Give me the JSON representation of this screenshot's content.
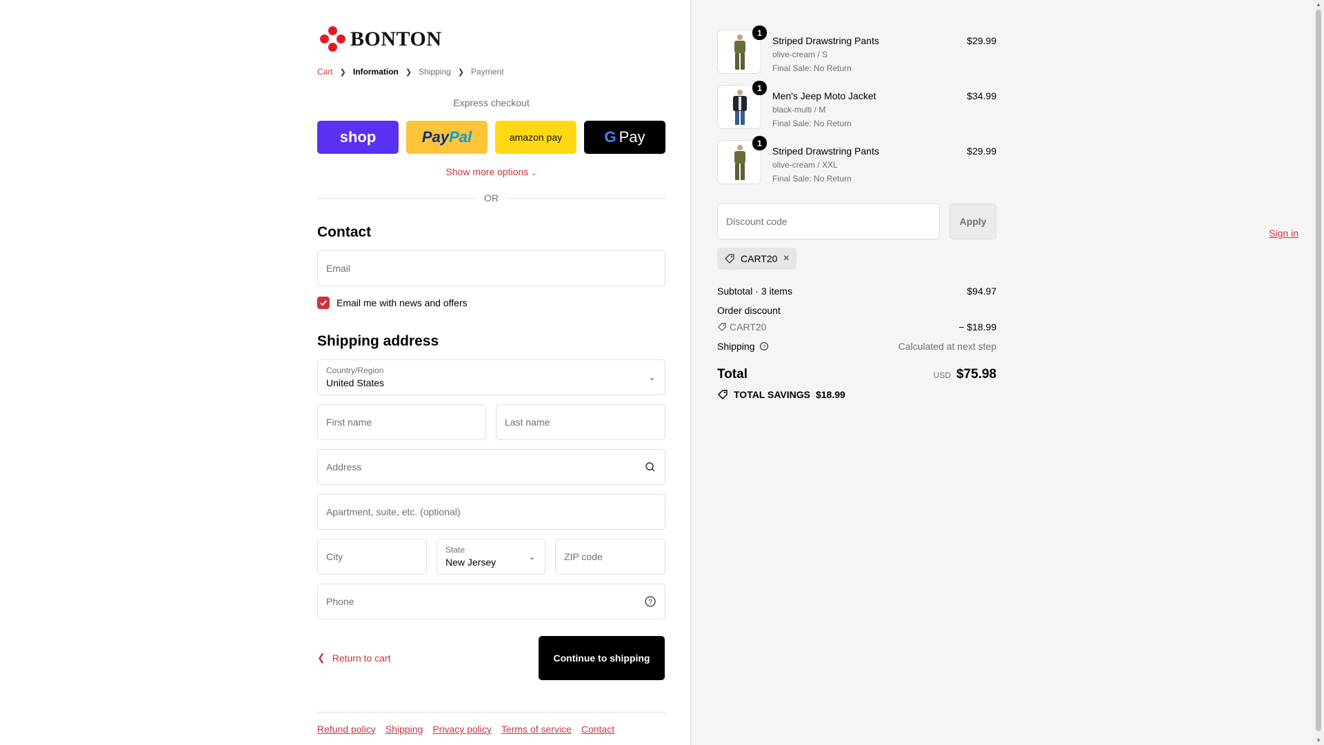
{
  "brand": {
    "name": "BONTON",
    "color": "#e31b23"
  },
  "breadcrumb": {
    "cart": "Cart",
    "information": "Information",
    "shipping": "Shipping",
    "payment": "Payment"
  },
  "express": {
    "title": "Express checkout",
    "shop": "shop",
    "paypal_a": "Pay",
    "paypal_b": "Pal",
    "amazon": "amazon pay",
    "gpay_g": "G",
    "gpay": "Pay",
    "show_more": "Show more options",
    "or": "OR"
  },
  "contact": {
    "heading": "Contact",
    "sign_in": "Sign in",
    "email_placeholder": "Email",
    "newsletter_label": "Email me with news and offers",
    "newsletter_checked": true
  },
  "shipping": {
    "heading": "Shipping address",
    "country_label": "Country/Region",
    "country_value": "United States",
    "first_name": "First name",
    "last_name": "Last name",
    "address": "Address",
    "apartment": "Apartment, suite, etc. (optional)",
    "city": "City",
    "state_label": "State",
    "state_value": "New Jersey",
    "zip": "ZIP code",
    "phone": "Phone"
  },
  "actions": {
    "return": "Return to cart",
    "continue": "Continue to shipping"
  },
  "footer": [
    "Refund policy",
    "Shipping",
    "Privacy policy",
    "Terms of service",
    "Contact"
  ],
  "cart": {
    "items": [
      {
        "name": "Striped Drawstring Pants",
        "variant": "olive-cream / S",
        "note": "Final Sale: No Return",
        "price": "$29.99",
        "qty": "1"
      },
      {
        "name": "Men's Jeep Moto Jacket",
        "variant": "black-multi / M",
        "note": "Final Sale: No Return",
        "price": "$34.99",
        "qty": "1"
      },
      {
        "name": "Striped Drawstring Pants",
        "variant": "olive-cream / XXL",
        "note": "Final Sale: No Return",
        "price": "$29.99",
        "qty": "1"
      }
    ],
    "discount_placeholder": "Discount code",
    "apply": "Apply",
    "applied_code": "CART20"
  },
  "summary": {
    "subtotal_label": "Subtotal · 3 items",
    "subtotal": "$94.97",
    "order_discount_label": "Order discount",
    "discount_code": "CART20",
    "discount_amount": "− $18.99",
    "shipping_label": "Shipping",
    "shipping_value": "Calculated at next step",
    "total_label": "Total",
    "currency": "USD",
    "total": "$75.98",
    "savings_label": "TOTAL SAVINGS",
    "savings": "$18.99"
  },
  "colors": {
    "accent": "#d1313d",
    "shop_pay": "#5a31f4",
    "paypal": "#ffc439",
    "amazon": "#ffd814"
  }
}
